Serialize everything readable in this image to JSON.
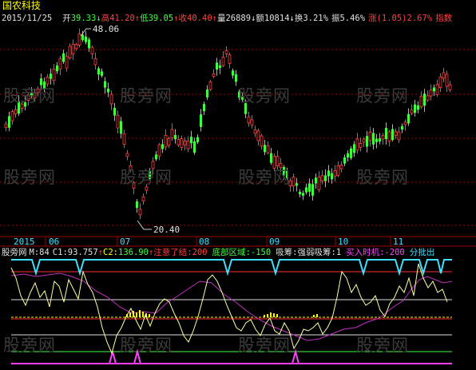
{
  "header": {
    "title": "国农科技",
    "date": "2015/11/25",
    "open_label": "开",
    "open_value": "39.33",
    "high_label": "高",
    "high_value": "41.20",
    "low_label": "低",
    "low_value": "39.05",
    "close_label": "收",
    "close_value": "40.40",
    "volume_label": "量",
    "volume_value": "26889",
    "amount_label": "额",
    "amount_value": "10814",
    "turnover_label": "换",
    "turnover_value": "3.21%",
    "amplitude_label": "振",
    "amplitude_value": "5.46%",
    "change_label": "涨",
    "change_value": "(1.05)2.67%",
    "trailing_text": "指数"
  },
  "price_annotations": {
    "high_marker": "48.06",
    "low_marker": "20.40"
  },
  "time_axis": [
    "2015",
    "06",
    "07",
    "08",
    "09",
    "10",
    "11"
  ],
  "indicator_header": {
    "name": "股旁网",
    "m_item": "M:84",
    "c1_item": "C1:93.757",
    "c2_item": "C2:",
    "bg_item": "136.90",
    "attention_label": "注意了结:200",
    "bottom_label": "底部区域:-150",
    "accumulate_label": "吸筹:强弱吸筹:1",
    "buy_label": "买入时机:-200",
    "batch_label": "分批出"
  },
  "watermark": "股旁网",
  "colors": {
    "up": "#ff4040",
    "down": "#40ff40",
    "grid": "#a00000",
    "white_text": "#ffffff",
    "yellow": "#ffff00",
    "cyan": "#40e0ff",
    "magenta": "#ff40ff",
    "label_green": "#40ff40"
  }
}
